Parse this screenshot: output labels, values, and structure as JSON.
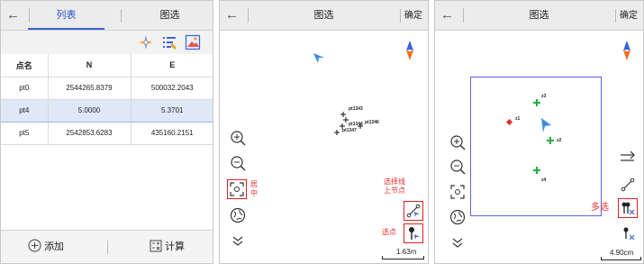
{
  "panel1": {
    "back_glyph": "←",
    "tabs": [
      {
        "label": "列表"
      },
      {
        "label": "图选"
      }
    ],
    "toolbar_icons": [
      "compass-point-icon",
      "list-edit-icon",
      "image-icon"
    ],
    "table": {
      "headers": [
        "点名",
        "N",
        "E"
      ],
      "rows": [
        [
          "pt0",
          "2544265.8379",
          "500032.2043"
        ],
        [
          "pt4",
          "5.0000",
          "5.3701"
        ],
        [
          "pt5",
          "2542853.6283",
          "435160.2151"
        ]
      ],
      "selected_row": 1
    },
    "bottom": {
      "add_label": "添加",
      "calc_label": "计算"
    }
  },
  "panel2": {
    "back_glyph": "←",
    "title": "图选",
    "confirm": "确定",
    "points": [
      "pt1343",
      "pt1344",
      "pt1346",
      "pt1347"
    ],
    "annotations": {
      "center": "居\n中",
      "select_line_node": "选择线\n上节点",
      "select_point": "选点"
    },
    "scale": "1.63m"
  },
  "panel3": {
    "back_glyph": "←",
    "title": "图选",
    "confirm": "确定",
    "points": [
      "z1",
      "z2",
      "z3",
      "z4"
    ],
    "annotations": {
      "multi_select": "多选"
    },
    "scale": "4.90cm"
  },
  "colors": {
    "accent": "#2a53c9",
    "highlight": "#e02020",
    "selected_row": "#dfe8f7"
  }
}
